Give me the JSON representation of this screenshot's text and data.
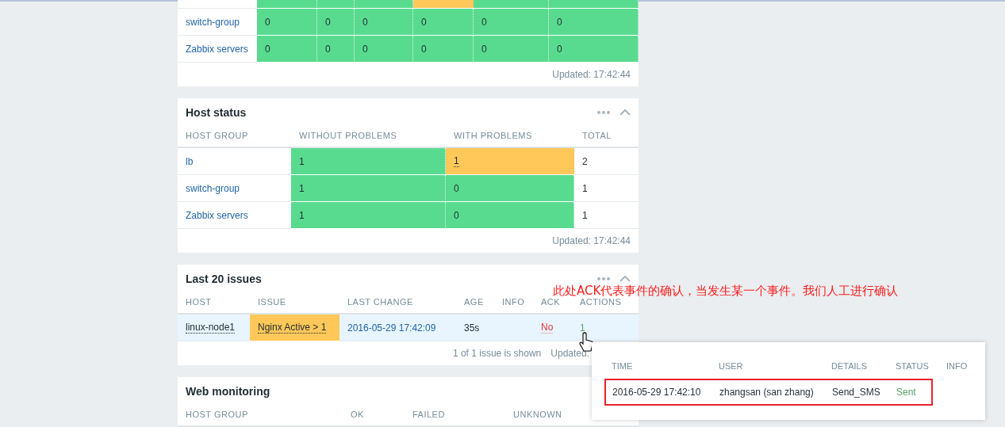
{
  "widgets": [
    {
      "kind": "severity",
      "rows": [
        {
          "cells": [
            {
              "kind": "blank"
            },
            {
              "kind": "text",
              "problem": false
            },
            {
              "kind": "text",
              "problem": false
            },
            {
              "kind": "text",
              "problem": false
            },
            {
              "kind": "text",
              "problem": true
            },
            {
              "kind": "text",
              "problem": false
            },
            {
              "kind": "text",
              "problem": false
            }
          ]
        },
        {
          "cells": [
            {
              "kind": "link",
              "text": "switch-group"
            },
            {
              "kind": "text",
              "text": "0",
              "problem": false
            },
            {
              "kind": "text",
              "text": "0",
              "problem": false
            },
            {
              "kind": "text",
              "text": "0",
              "problem": false
            },
            {
              "kind": "text",
              "text": "0",
              "problem": false
            },
            {
              "kind": "text",
              "text": "0",
              "problem": false
            },
            {
              "kind": "text",
              "text": "0",
              "problem": false
            }
          ]
        },
        {
          "cells": [
            {
              "kind": "link",
              "text": "Zabbix servers"
            },
            {
              "kind": "text",
              "text": "0",
              "problem": false
            },
            {
              "kind": "text",
              "text": "0",
              "problem": false
            },
            {
              "kind": "text",
              "text": "0",
              "problem": false
            },
            {
              "kind": "text",
              "text": "0",
              "problem": false
            },
            {
              "kind": "text",
              "text": "0",
              "problem": false
            },
            {
              "kind": "text",
              "text": "0",
              "problem": false
            }
          ]
        }
      ],
      "footer": [
        "Updated: 17:42:44"
      ]
    },
    {
      "kind": "hosts",
      "title": "Host status",
      "columns": [
        "HOST GROUP",
        "WITHOUT PROBLEMS",
        "WITH PROBLEMS",
        "TOTAL"
      ],
      "rows": [
        {
          "cells": [
            {
              "kind": "link",
              "text": "lb"
            },
            {
              "kind": "text",
              "text": "1",
              "problem": false
            },
            {
              "kind": "issue",
              "text": "1",
              "problem": true
            },
            {
              "kind": "text",
              "text": "2"
            }
          ]
        },
        {
          "cells": [
            {
              "kind": "link",
              "text": "switch-group"
            },
            {
              "kind": "text",
              "text": "1",
              "problem": false
            },
            {
              "kind": "text",
              "text": "0",
              "problem": false
            },
            {
              "kind": "text",
              "text": "1"
            }
          ]
        },
        {
          "cells": [
            {
              "kind": "link",
              "text": "Zabbix servers"
            },
            {
              "kind": "text",
              "text": "1",
              "problem": false
            },
            {
              "kind": "text",
              "text": "0",
              "problem": false
            },
            {
              "kind": "text",
              "text": "1"
            }
          ]
        }
      ],
      "footer": [
        "Updated: 17:42:44"
      ]
    },
    {
      "kind": "issues",
      "title": "Last 20 issues",
      "columns": [
        "HOST",
        "ISSUE",
        "LAST CHANGE",
        "AGE",
        "INFO",
        "ACK",
        "ACTIONS"
      ],
      "rows": [
        {
          "highlighted": true,
          "cells": [
            {
              "kind": "host",
              "text": "linux-node1"
            },
            {
              "kind": "issue",
              "text": "Nginx Active > 1",
              "problem": true
            },
            {
              "kind": "time",
              "text": "2016-05-29 17:42:09"
            },
            {
              "kind": "text",
              "text": "35s"
            },
            {
              "kind": "blank"
            },
            {
              "kind": "ack",
              "text": "No"
            },
            {
              "kind": "action",
              "text": "1"
            }
          ]
        }
      ],
      "footer": [
        "1 of 1 issue is shown",
        "Updated:"
      ]
    },
    {
      "kind": "web",
      "title": "Web monitoring",
      "columns": [
        "HOST GROUP",
        "OK",
        "FAILED",
        "UNKNOWN"
      ]
    }
  ],
  "annotation": {
    "text": "此处ACK代表事件的确认，当发生某一个事件。我们人工进行确认"
  },
  "popup": {
    "columns": [
      "TIME",
      "USER",
      "DETAILS",
      "STATUS",
      "INFO"
    ],
    "rows": [
      {
        "marked": true,
        "time": "2016-05-29 17:42:10",
        "user": "zhangsan (san zhang)",
        "details": "Send_SMS",
        "status": "Sent"
      }
    ]
  }
}
